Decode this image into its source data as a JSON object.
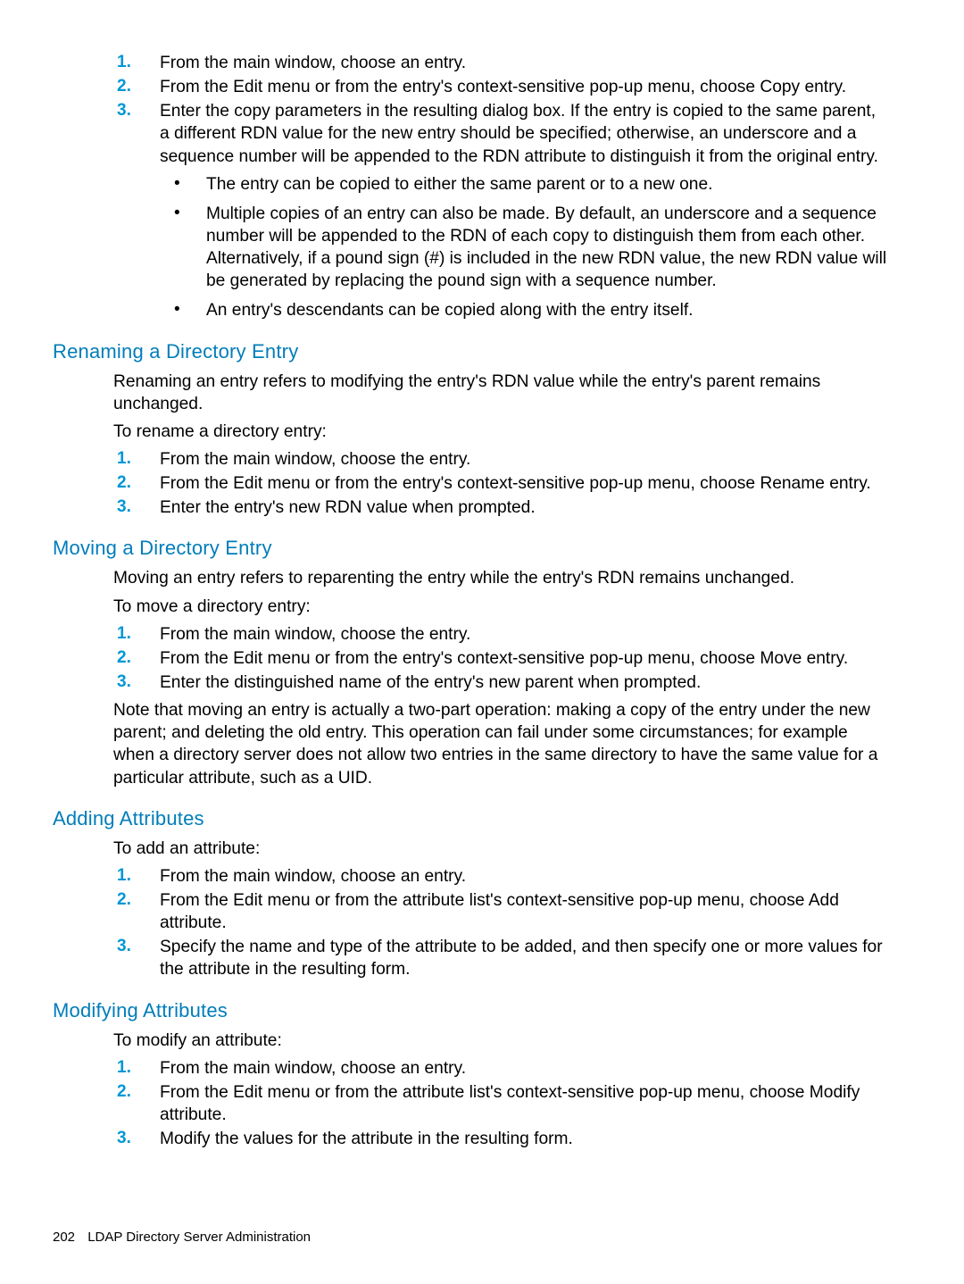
{
  "copy_entry": {
    "step1": "From the main window, choose an entry.",
    "step2": "From the Edit menu or from the entry's context-sensitive pop-up menu, choose Copy entry.",
    "step3": "Enter the copy parameters in the resulting dialog box. If the entry is copied to the same parent, a different RDN value for the new entry should be specified; otherwise, an underscore and a sequence number will be appended to the RDN attribute to distinguish it from the original entry.",
    "bullet1": "The entry can be copied to either the same parent or to a new one.",
    "bullet2": "Multiple copies of an entry can also be made. By default, an underscore and a sequence number will be appended to the RDN of each copy to distinguish them from each other. Alternatively, if a pound sign (#) is included in the new RDN value, the new RDN value will be generated by replacing the pound sign with a sequence number.",
    "bullet3": "An entry's descendants can be copied along with the entry itself."
  },
  "renaming": {
    "heading": "Renaming a Directory Entry",
    "intro": "Renaming an entry refers to modifying the entry's RDN value while the entry's parent remains unchanged.",
    "lead": "To rename a directory entry:",
    "step1": "From the main window, choose the entry.",
    "step2": "From the Edit menu or from the entry's context-sensitive pop-up menu, choose Rename entry.",
    "step3": "Enter the entry's new RDN value when prompted."
  },
  "moving": {
    "heading": "Moving a Directory Entry",
    "intro": "Moving an entry refers to reparenting the entry while the entry's RDN remains unchanged.",
    "lead": "To move a directory entry:",
    "step1": "From the main window, choose the entry.",
    "step2": "From the Edit menu or from the entry's context-sensitive pop-up menu, choose Move entry.",
    "step3": "Enter the distinguished name of the entry's new parent when prompted.",
    "note": "Note that moving an entry is actually a two-part operation: making a copy of the entry under the new parent; and deleting the old entry. This operation can fail under some circumstances; for example when a directory server does not allow two entries in the same directory to have the same value for a particular attribute, such as a UID."
  },
  "adding": {
    "heading": "Adding Attributes",
    "lead": "To add an attribute:",
    "step1": "From the main window, choose an entry.",
    "step2": "From the Edit menu or from the attribute list's context-sensitive pop-up menu, choose Add attribute.",
    "step3": "Specify the name and type of the attribute to be added, and then specify one or more values for the attribute in the resulting form."
  },
  "modifying": {
    "heading": "Modifying Attributes",
    "lead": "To modify an attribute:",
    "step1": "From the main window, choose an entry.",
    "step2": "From the Edit menu or from the attribute list's context-sensitive pop-up menu, choose Modify attribute.",
    "step3": "Modify the values for the attribute in the resulting form."
  },
  "markers": {
    "m1": "1.",
    "m2": "2.",
    "m3": "3."
  },
  "footer": {
    "page": "202",
    "title": "LDAP Directory Server Administration"
  }
}
